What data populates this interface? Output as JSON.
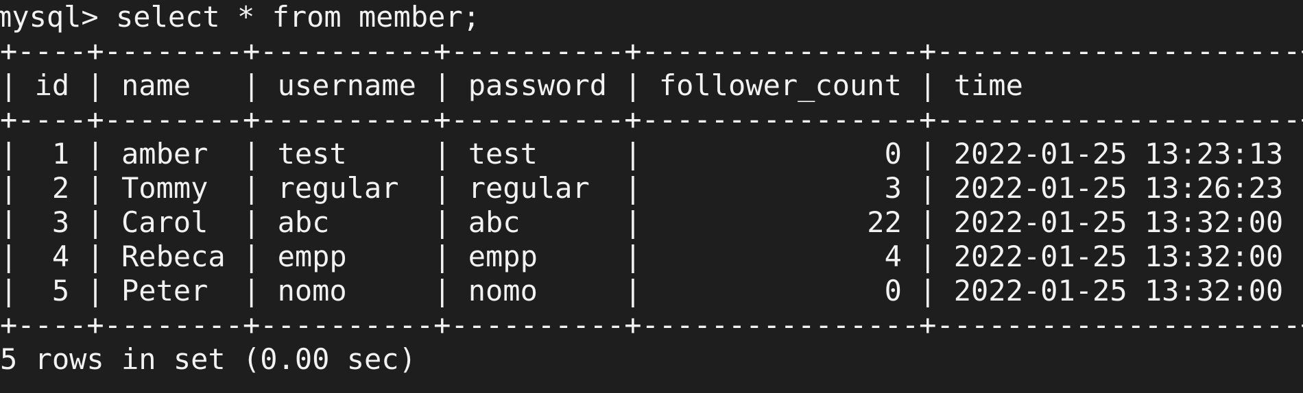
{
  "terminal": {
    "command": "mysql> select * from member;",
    "separator": "+----+--------+----------+----------+----------------+---------------------+",
    "header": "| id | name   | username | password | follower_count | time                |",
    "table": {
      "columns": [
        "id",
        "name",
        "username",
        "password",
        "follower_count",
        "time"
      ],
      "rows": [
        {
          "id": "1",
          "name": "amber",
          "username": "test",
          "password": "test",
          "follower_count": "0",
          "time": "2022-01-25 13:23:13"
        },
        {
          "id": "2",
          "name": "Tommy",
          "username": "regular",
          "password": "regular",
          "follower_count": "3",
          "time": "2022-01-25 13:26:23"
        },
        {
          "id": "3",
          "name": "Carol",
          "username": "abc",
          "password": "abc",
          "follower_count": "22",
          "time": "2022-01-25 13:32:00"
        },
        {
          "id": "4",
          "name": "Rebeca",
          "username": "empp",
          "password": "empp",
          "follower_count": "4",
          "time": "2022-01-25 13:32:00"
        },
        {
          "id": "5",
          "name": "Peter",
          "username": "nomo",
          "password": "nomo",
          "follower_count": "0",
          "time": "2022-01-25 13:32:00"
        }
      ]
    },
    "row_lines": [
      "|  1 | amber  | test     | test     |              0 | 2022-01-25 13:23:13 |",
      "|  2 | Tommy  | regular  | regular  |              3 | 2022-01-25 13:26:23 |",
      "|  3 | Carol  | abc      | abc      |             22 | 2022-01-25 13:32:00 |",
      "|  4 | Rebeca | empp     | empp     |              4 | 2022-01-25 13:32:00 |",
      "|  5 | Peter  | nomo     | nomo     |              0 | 2022-01-25 13:32:00 |"
    ],
    "result": "5 rows in set (0.00 sec)",
    "colors": {
      "background": "#1e1e1e",
      "foreground": "#f2f2f2"
    }
  }
}
